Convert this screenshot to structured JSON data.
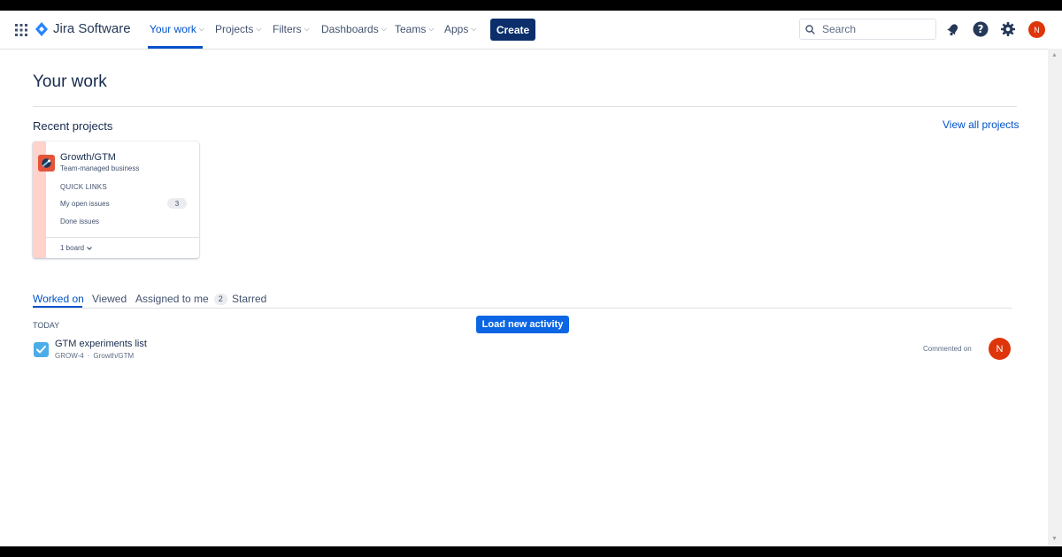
{
  "header": {
    "app_name": "Jira Software",
    "nav": [
      {
        "label": "Your work"
      },
      {
        "label": "Projects"
      },
      {
        "label": "Filters"
      },
      {
        "label": "Dashboards"
      },
      {
        "label": "Teams"
      },
      {
        "label": "Apps"
      }
    ],
    "create_label": "Create",
    "search_placeholder": "Search",
    "avatar_initial": "N"
  },
  "page": {
    "title": "Your work",
    "recent_projects_title": "Recent projects",
    "view_all_label": "View all projects"
  },
  "project_card": {
    "name": "Growth/GTM",
    "type": "Team-managed business",
    "quick_links_label": "QUICK LINKS",
    "links": [
      {
        "label": "My open issues",
        "count": "3"
      },
      {
        "label": "Done issues"
      }
    ],
    "board_label": "1 board"
  },
  "tabs": [
    {
      "label": "Worked on"
    },
    {
      "label": "Viewed"
    },
    {
      "label": "Assigned to me",
      "badge": "2"
    },
    {
      "label": "Starred"
    }
  ],
  "activity": {
    "group_label": "TODAY",
    "load_button": "Load new activity",
    "items": [
      {
        "title": "GTM experiments list",
        "key": "GROW-4",
        "separator": "·",
        "project": "Growth/GTM",
        "status": "Commented on",
        "avatar_initial": "N"
      }
    ]
  },
  "colors": {
    "accent": "#0052CC",
    "create_button": "#0C2F6B",
    "load_button": "#0C66E4",
    "avatar": "#DE350B",
    "card_stripe": "#FFD2CC",
    "task_icon": "#4BADE8"
  }
}
